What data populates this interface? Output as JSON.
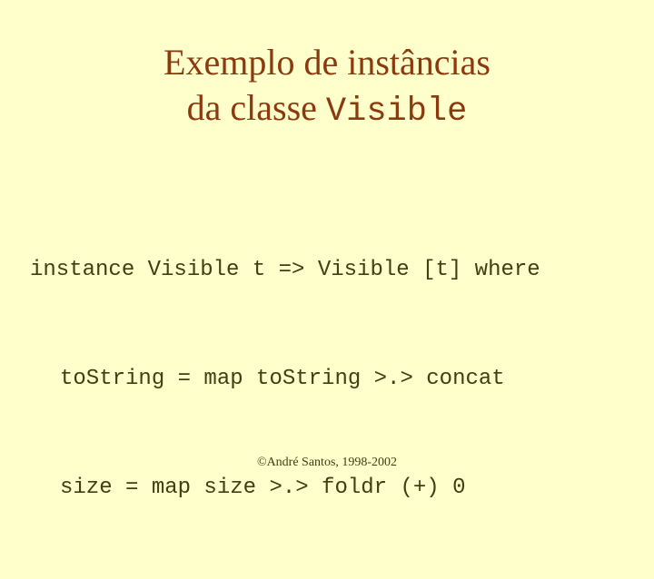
{
  "slide": {
    "title": {
      "line1": "Exemplo de instâncias",
      "line2_text": "da classe ",
      "line2_code": "Visible"
    },
    "code": {
      "lines": [
        "instance Visible t => Visible [t] where",
        "toString = map toString >.> concat",
        "size = map size >.> foldr (+) 0"
      ]
    },
    "footer": "©André Santos, 1998-2002",
    "colors": {
      "background": "#FFFFCC",
      "title": "#8B3A0F",
      "code": "#3F3F10"
    }
  }
}
